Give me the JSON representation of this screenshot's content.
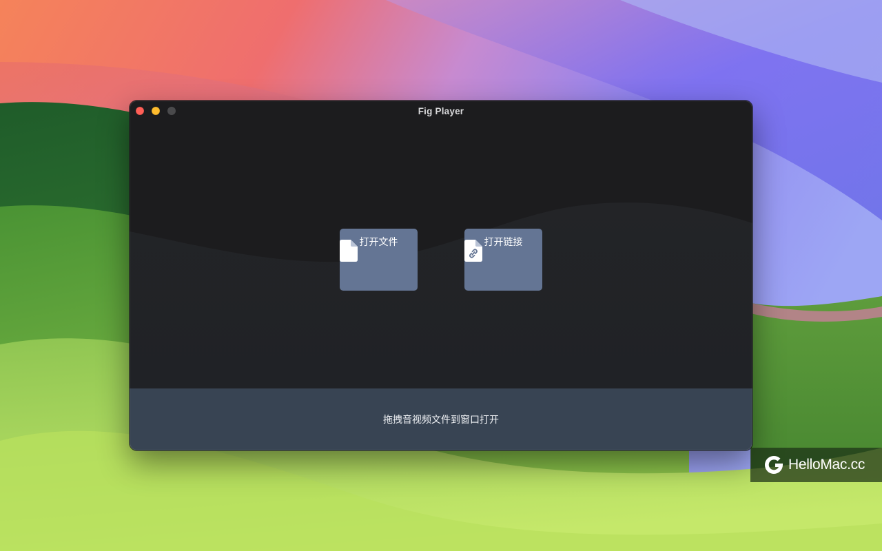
{
  "window": {
    "title": "Fig Player",
    "traffic_lights": {
      "close_color": "#ff5f57",
      "minimize_color": "#febc2e",
      "zoom_color": "#4a4a4c"
    }
  },
  "main": {
    "buttons": [
      {
        "label": "打开文件",
        "icon": "document-icon"
      },
      {
        "label": "打开链接",
        "icon": "document-link-icon"
      }
    ],
    "button_color": "#647594",
    "drop_hint": "拖拽音视频文件到窗口打开",
    "drop_bar_color": "#384453"
  },
  "watermark": {
    "text": "HelloMac.cc",
    "icon": "hellomac-logo-icon"
  }
}
